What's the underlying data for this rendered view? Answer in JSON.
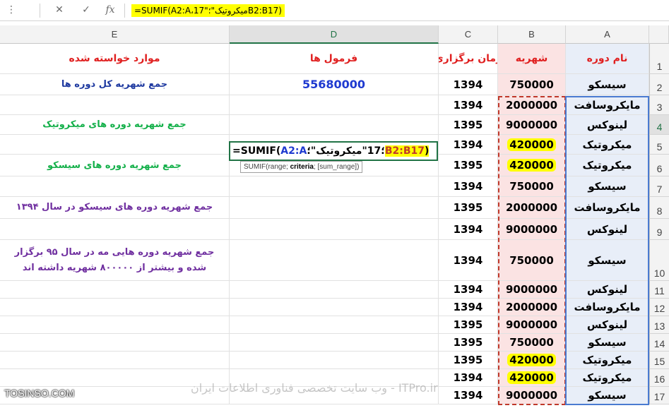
{
  "formula_bar": {
    "cancel_icon": "✕",
    "enter_icon": "✓",
    "fx_icon": "fx",
    "formula": "=SUMIF(A2:A،17\"میکروتیک\"؛B2:B17)"
  },
  "columns": [
    "E",
    "D",
    "C",
    "B",
    "A"
  ],
  "headers": {
    "E": "موارد خواسته شده",
    "D": "فرمول ها",
    "C": "زمان برگزاری",
    "B": "شهریه",
    "A": "نام دوره"
  },
  "rows": [
    {
      "num": "2",
      "A": "سیسکو",
      "B": "750000",
      "C": "1394",
      "D": "55680000",
      "E": "جمع شهریه کل دوره ها"
    },
    {
      "num": "3",
      "A": "مایکروسافت",
      "B": "2000000",
      "C": "1394",
      "D": "",
      "E": ""
    },
    {
      "num": "4",
      "A": "لینوکس",
      "B": "9000000",
      "C": "1395",
      "D": "",
      "E": "جمع شهریه دوره های میکروتیک"
    },
    {
      "num": "5",
      "A": "میکروتیک",
      "B": "420000",
      "C": "1394",
      "D": "",
      "E": ""
    },
    {
      "num": "6",
      "A": "میکروتیک",
      "B": "420000",
      "C": "1395",
      "D": "",
      "E": "جمع شهریه دوره های سیسکو"
    },
    {
      "num": "7",
      "A": "سیسکو",
      "B": "750000",
      "C": "1394",
      "D": "",
      "E": ""
    },
    {
      "num": "8",
      "A": "مایکروسافت",
      "B": "2000000",
      "C": "1395",
      "D": "",
      "E": "جمع شهریه دوره های سیسکو در سال ۱۳۹۴"
    },
    {
      "num": "9",
      "A": "لینوکس",
      "B": "9000000",
      "C": "1394",
      "D": "",
      "E": ""
    },
    {
      "num": "10",
      "A": "سیسکو",
      "B": "750000",
      "C": "1394",
      "D": "",
      "E": "جمع شهریه دوره هایی مه در سال ۹۵ برگزار شده و بیشتر از ۸۰۰۰۰۰ شهریه داشته اند"
    },
    {
      "num": "11",
      "A": "لینوکس",
      "B": "9000000",
      "C": "1394",
      "D": "",
      "E": ""
    },
    {
      "num": "12",
      "A": "مایکروسافت",
      "B": "2000000",
      "C": "1394",
      "D": "",
      "E": ""
    },
    {
      "num": "13",
      "A": "لینوکس",
      "B": "9000000",
      "C": "1395",
      "D": "",
      "E": ""
    },
    {
      "num": "14",
      "A": "سیسکو",
      "B": "750000",
      "C": "1395",
      "D": "",
      "E": ""
    },
    {
      "num": "15",
      "A": "میکروتیک",
      "B": "420000",
      "C": "1395",
      "D": "",
      "E": ""
    },
    {
      "num": "16",
      "A": "میکروتیک",
      "B": "420000",
      "C": "1394",
      "D": "",
      "E": ""
    },
    {
      "num": "17",
      "A": "سیسکو",
      "B": "9000000",
      "C": "1394",
      "D": "",
      "E": ""
    }
  ],
  "header_row_num": "1",
  "edit_cell": {
    "prefix": "=SUMIF(",
    "range": "A2:A",
    "sep": "؛17\"میکروتیک\"؛",
    "sum_range": "B2:B17",
    "suffix": ")"
  },
  "tooltip": {
    "fn": "SUMIF(range; ",
    "criteria": "criteria",
    "rest": "; [sum_range])"
  },
  "watermarks": {
    "left": "TOSINSO.COM",
    "center": "ITPro.ir - وب سایت تخصصی فناوری اطلاعات ایران"
  },
  "colors": {
    "header_text": "#e02020",
    "total": "#1f3ad0",
    "highlight": "#ffff00",
    "selection": "#217346"
  }
}
